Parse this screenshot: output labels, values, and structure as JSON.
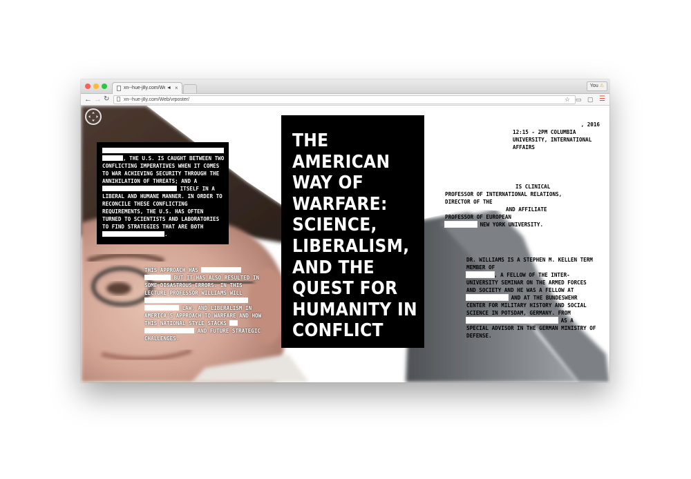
{
  "browser": {
    "tab_title": "xn--hue-j8y.com/Web/…",
    "tab_sound_icon": "speaker-icon",
    "user_label": "You",
    "url": "xn--hue-j8y.com/Web/vrposter/"
  },
  "poster": {
    "title": "THE AMERICAN WAY OF WARFARE: SCIENCE, LIBERALISM, AND THE QUEST FOR HUMANITY IN CONFLICT",
    "intro": {
      "p1": ", THE U.S. IS CAUGHT BETWEEN TWO CONFLICTING IMPERATIVES WHEN IT COMES TO WAR ACHIEVING SECURITY THROUGH THE ANNIHILATION OF THREATS; AND A",
      "p2": "ITSELF IN A LIBERAL AND HUMANE MANNER. IN ORDER TO RECONCILE THESE CONFLICTING REQUIREMENTS, THE U.S. HAS OFTEN TURNED TO SCIENTISTS AND LABORATORIES TO FIND STRATEGIES THAT ARE BOTH",
      "p3": "."
    },
    "approach": {
      "a1": "THIS APPROACH HAS",
      "a2": "BUT IT HAS ALSO RESULTED IN SOME DISASTROUS ERRORS. IN THIS LECTURE PROFESSOR WILLIAMS WILL",
      "a3": "LAW, AND LIBERALISM IN AMERICA'S APPROACH TO WARFARE AND HOW THIS NATIONAL STYLE STACKS",
      "a4": "AND FUTURE STRATEGIC CHALLENGES."
    },
    "event": {
      "year": ", 2016",
      "time_place": "12:15 - 2PM COLUMBIA UNIVERSITY, INTERNATIONAL AFFAIRS"
    },
    "bio1": {
      "b1": "IS CLINICAL",
      "b2": "PROFESSOR OF INTERNATIONAL RELATIONS, DIRECTOR OF THE",
      "b3": "AND AFFILIATE",
      "b4": "PROFESSOR OF EUROPEAN",
      "b5": "NEW YORK UNIVERSITY."
    },
    "bio2": {
      "c1": "DR. WILLIAMS IS A STEPHEN M. KELLEN TERM MEMBER OF",
      "c2": ", A FELLOW OF THE INTER-UNIVERSITY SEMINAR ON THE ARMED FORCES AND SOCIETY AND HE WAS A FELLOW AT",
      "c3": "AND AT THE BUNDESWEHR CENTER FOR MILITARY HISTORY AND SOCIAL SCIENCE IN POTSDAM, GERMANY. FROM",
      "c4": "AS A",
      "c5": "SPECIAL ADVISOR IN THE GERMAN MINISTRY OF DEFENSE."
    }
  },
  "colors": {
    "close": "#fc5f57",
    "minimize": "#fdbc2e",
    "zoom": "#28c840",
    "menu": "#e04b3f"
  }
}
